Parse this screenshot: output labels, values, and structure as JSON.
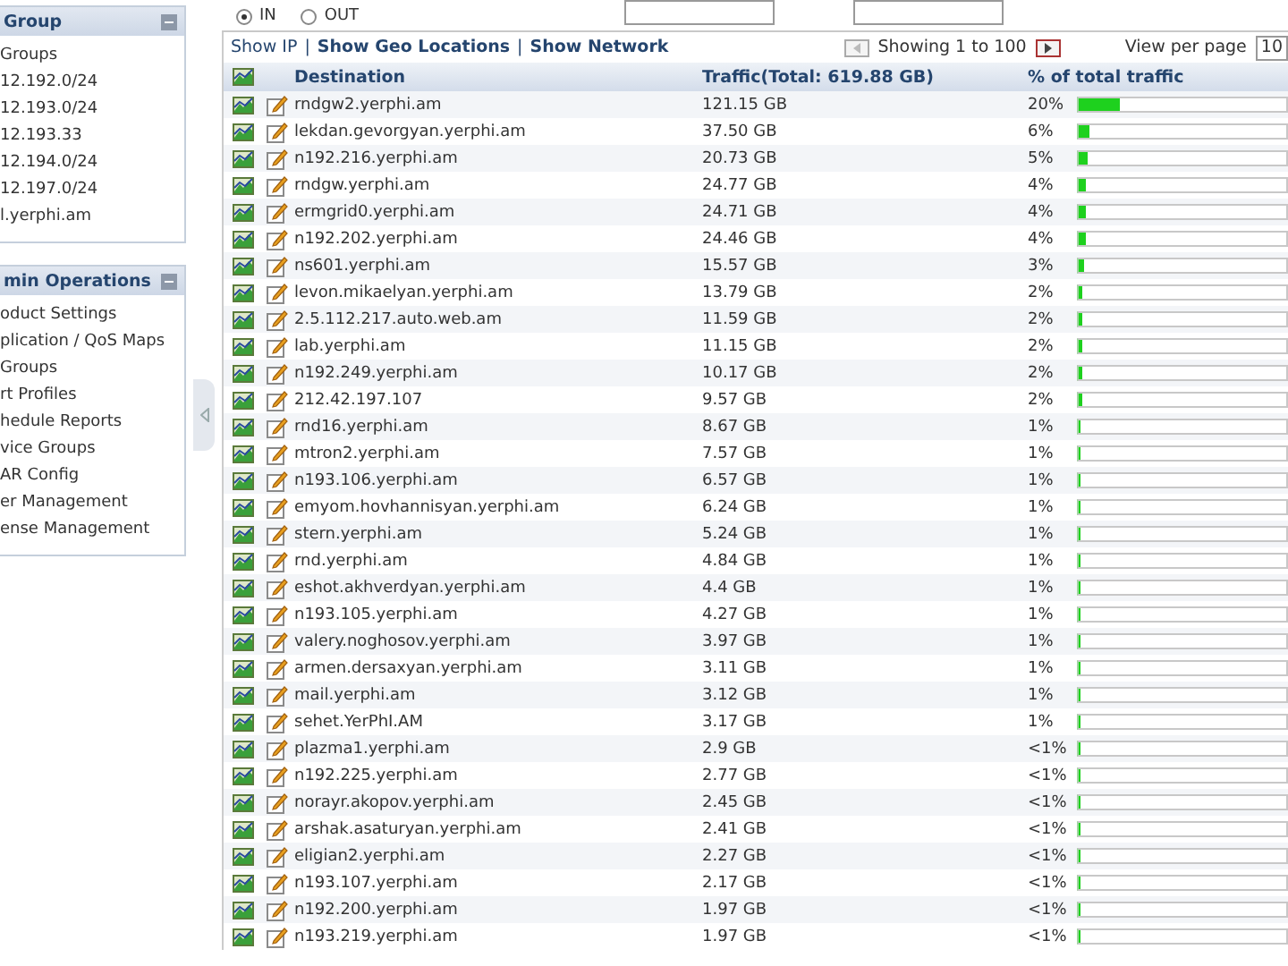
{
  "sidebar": {
    "panels": [
      {
        "title": "Group",
        "expanded": true,
        "items": [
          "Groups",
          "12.192.0/24",
          "12.193.0/24",
          "12.193.33",
          "12.194.0/24",
          "12.197.0/24",
          "l.yerphi.am"
        ]
      },
      {
        "title": "min Operations",
        "expanded": true,
        "items": [
          "oduct Settings",
          "plication / QoS Maps",
          "Groups",
          "rt Profiles",
          "hedule Reports",
          "vice Groups",
          "AR Config",
          "er Management",
          "ense Management"
        ]
      }
    ]
  },
  "direction_filter": [
    {
      "label": "IN",
      "selected": true
    },
    {
      "label": "OUT",
      "selected": false
    }
  ],
  "view_links": {
    "items": [
      "Show IP",
      "Show Geo Locations",
      "Show Network"
    ],
    "separator": "|"
  },
  "pagination": {
    "showing": "Showing 1 to 100",
    "per_page_label": "View per page",
    "per_page": "10"
  },
  "table": {
    "columns": [
      "Destination",
      "Traffic(Total: 619.88 GB)",
      "% of total traffic"
    ],
    "rows": [
      {
        "destination": "rndgw2.yerphi.am",
        "traffic": "121.15 GB",
        "percent": "20%",
        "level": 0.2
      },
      {
        "destination": "lekdan.gevorgyan.yerphi.am",
        "traffic": "37.50 GB",
        "percent": "6%",
        "level": 0.06
      },
      {
        "destination": "n192.216.yerphi.am",
        "traffic": "20.73 GB",
        "percent": "5%",
        "level": 0.05
      },
      {
        "destination": "rndgw.yerphi.am",
        "traffic": "24.77 GB",
        "percent": "4%",
        "level": 0.04
      },
      {
        "destination": "ermgrid0.yerphi.am",
        "traffic": "24.71 GB",
        "percent": "4%",
        "level": 0.04
      },
      {
        "destination": "n192.202.yerphi.am",
        "traffic": "24.46 GB",
        "percent": "4%",
        "level": 0.04
      },
      {
        "destination": "ns601.yerphi.am",
        "traffic": "15.57 GB",
        "percent": "3%",
        "level": 0.03
      },
      {
        "destination": "levon.mikaelyan.yerphi.am",
        "traffic": "13.79 GB",
        "percent": "2%",
        "level": 0.02
      },
      {
        "destination": "2.5.112.217.auto.web.am",
        "traffic": "11.59 GB",
        "percent": "2%",
        "level": 0.02
      },
      {
        "destination": "lab.yerphi.am",
        "traffic": "11.15 GB",
        "percent": "2%",
        "level": 0.02
      },
      {
        "destination": "n192.249.yerphi.am",
        "traffic": "10.17 GB",
        "percent": "2%",
        "level": 0.02
      },
      {
        "destination": "212.42.197.107",
        "traffic": "9.57 GB",
        "percent": "2%",
        "level": 0.02
      },
      {
        "destination": "rnd16.yerphi.am",
        "traffic": "8.67 GB",
        "percent": "1%",
        "level": 0.01
      },
      {
        "destination": "mtron2.yerphi.am",
        "traffic": "7.57 GB",
        "percent": "1%",
        "level": 0.01
      },
      {
        "destination": "n193.106.yerphi.am",
        "traffic": "6.57 GB",
        "percent": "1%",
        "level": 0.01
      },
      {
        "destination": "emyom.hovhannisyan.yerphi.am",
        "traffic": "6.24 GB",
        "percent": "1%",
        "level": 0.01
      },
      {
        "destination": "stern.yerphi.am",
        "traffic": "5.24 GB",
        "percent": "1%",
        "level": 0.01
      },
      {
        "destination": "rnd.yerphi.am",
        "traffic": "4.84 GB",
        "percent": "1%",
        "level": 0.01
      },
      {
        "destination": "eshot.akhverdyan.yerphi.am",
        "traffic": "4.4 GB",
        "percent": "1%",
        "level": 0.01
      },
      {
        "destination": "n193.105.yerphi.am",
        "traffic": "4.27 GB",
        "percent": "1%",
        "level": 0.01
      },
      {
        "destination": "valery.noghosov.yerphi.am",
        "traffic": "3.97 GB",
        "percent": "1%",
        "level": 0.01
      },
      {
        "destination": "armen.dersaxyan.yerphi.am",
        "traffic": "3.11 GB",
        "percent": "1%",
        "level": 0.01
      },
      {
        "destination": "mail.yerphi.am",
        "traffic": "3.12 GB",
        "percent": "1%",
        "level": 0.01
      },
      {
        "destination": "sehet.YerPhI.AM",
        "traffic": "3.17 GB",
        "percent": "1%",
        "level": 0.01
      },
      {
        "destination": "plazma1.yerphi.am",
        "traffic": "2.9 GB",
        "percent": "<1%",
        "level": 0.005
      },
      {
        "destination": "n192.225.yerphi.am",
        "traffic": "2.77 GB",
        "percent": "<1%",
        "level": 0.005
      },
      {
        "destination": "norayr.akopov.yerphi.am",
        "traffic": "2.45 GB",
        "percent": "<1%",
        "level": 0.005
      },
      {
        "destination": "arshak.asaturyan.yerphi.am",
        "traffic": "2.41 GB",
        "percent": "<1%",
        "level": 0.005
      },
      {
        "destination": "eligian2.yerphi.am",
        "traffic": "2.27 GB",
        "percent": "<1%",
        "level": 0.005
      },
      {
        "destination": "n193.107.yerphi.am",
        "traffic": "2.17 GB",
        "percent": "<1%",
        "level": 0.005
      },
      {
        "destination": "n192.200.yerphi.am",
        "traffic": "1.97 GB",
        "percent": "<1%",
        "level": 0.005
      },
      {
        "destination": "n193.219.yerphi.am",
        "traffic": "1.97 GB",
        "percent": "<1%",
        "level": 0.005
      }
    ]
  }
}
